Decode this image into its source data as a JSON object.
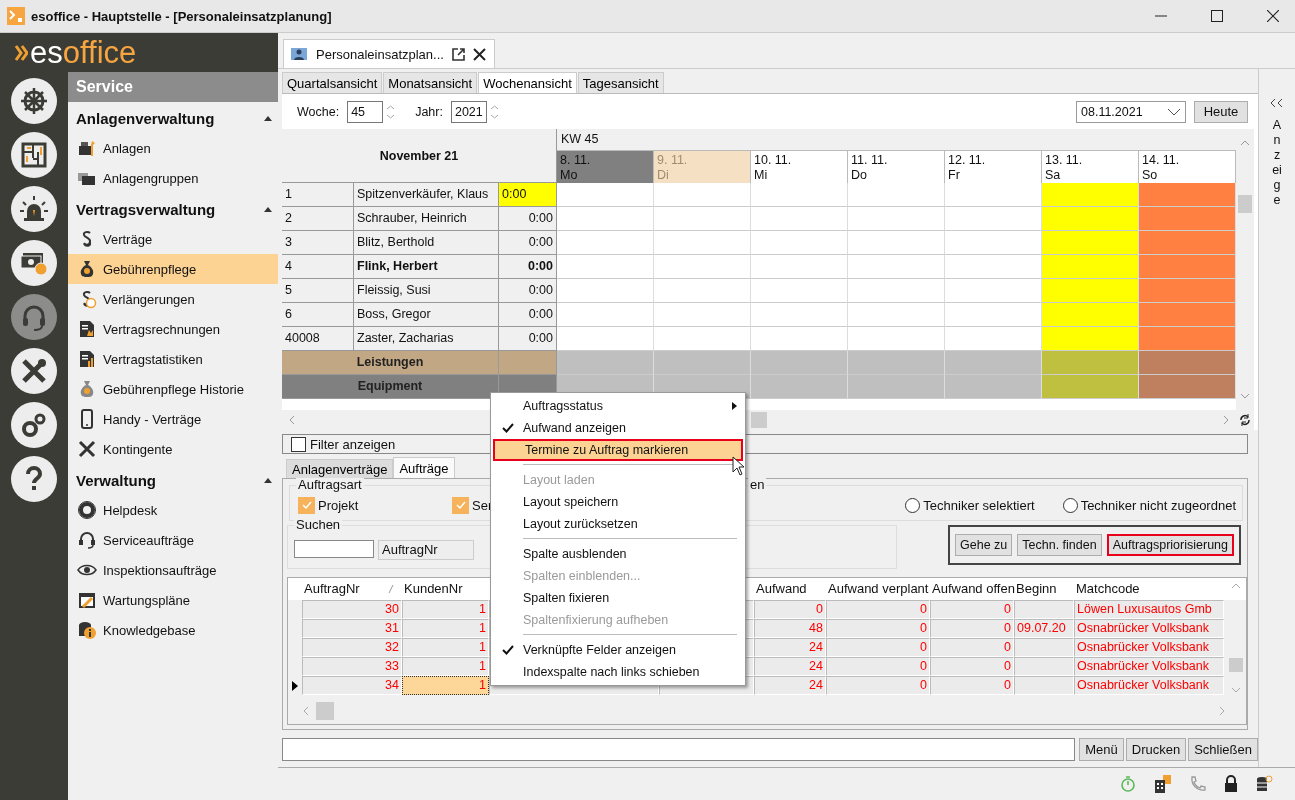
{
  "window": {
    "title": "esoffice - Hauptstelle - [Personaleinsatzplanung]"
  },
  "logo": {
    "part_1": "es",
    "part_2": "office"
  },
  "rail": [
    {
      "selected": false
    },
    {
      "selected": false
    },
    {
      "selected": false
    },
    {
      "selected": false
    },
    {
      "selected": true
    },
    {
      "selected": false
    },
    {
      "selected": false
    },
    {
      "selected": false
    }
  ],
  "sidebar": {
    "title": "Service",
    "sections": [
      {
        "title": "Anlagenverwaltung",
        "expanded": true,
        "items": [
          {
            "label": "Anlagen",
            "selected": false
          },
          {
            "label": "Anlagengruppen",
            "selected": false
          }
        ]
      },
      {
        "title": "Vertragsverwaltung",
        "expanded": true,
        "items": [
          {
            "label": "Verträge",
            "selected": false
          },
          {
            "label": "Gebührenpflege",
            "selected": true
          },
          {
            "label": "Verlängerungen",
            "selected": false
          },
          {
            "label": "Vertragsrechnungen",
            "selected": false
          },
          {
            "label": "Vertragstatistiken",
            "selected": false
          },
          {
            "label": "Gebührenpflege Historie",
            "selected": false
          },
          {
            "label": "Handy - Verträge",
            "selected": false
          },
          {
            "label": "Kontingente",
            "selected": false
          }
        ]
      },
      {
        "title": "Verwaltung",
        "expanded": true,
        "items": [
          {
            "label": "Helpdesk",
            "selected": false
          },
          {
            "label": "Serviceaufträge",
            "selected": false
          },
          {
            "label": "Inspektionsaufträge",
            "selected": false
          },
          {
            "label": "Wartungspläne",
            "selected": false
          },
          {
            "label": "Knowledgebase",
            "selected": false
          }
        ]
      }
    ]
  },
  "document_tab": {
    "title": "Personaleinsatzplan..."
  },
  "view_tabs": [
    {
      "label": "Quartalsansicht",
      "selected": false
    },
    {
      "label": "Monatsansicht",
      "selected": false
    },
    {
      "label": "Wochenansicht",
      "selected": true
    },
    {
      "label": "Tagesansicht",
      "selected": false
    }
  ],
  "toolbar": {
    "week_label": "Woche:",
    "week": "45",
    "year_label": "Jahr:",
    "year": "2021",
    "date": "08.11.2021",
    "today_button": "Heute"
  },
  "side_panel": {
    "title": "Anzeige"
  },
  "planner": {
    "month": "November 21",
    "week": "KW 45",
    "days": [
      {
        "date": "8. 11.",
        "weekday": "Mo",
        "selected": true,
        "today": false,
        "color": "#ffffff"
      },
      {
        "date": "9. 11.",
        "weekday": "Di",
        "selected": false,
        "today": true,
        "color": "#ffffff"
      },
      {
        "date": "10. 11.",
        "weekday": "Mi",
        "selected": false,
        "today": false,
        "color": "#ffffff"
      },
      {
        "date": "11. 11.",
        "weekday": "Do",
        "selected": false,
        "today": false,
        "color": "#ffffff"
      },
      {
        "date": "12. 11.",
        "weekday": "Fr",
        "selected": false,
        "today": false,
        "color": "#ffffff"
      },
      {
        "date": "13. 11.",
        "weekday": "Sa",
        "selected": false,
        "today": false,
        "color": "#ffff00"
      },
      {
        "date": "14. 11.",
        "weekday": "So",
        "selected": false,
        "today": false,
        "color": "#ff8040"
      }
    ],
    "rows": [
      {
        "kind": "person",
        "number": "1",
        "name": "Spitzenverkäufer, Klaus",
        "hours": "0:00",
        "marked": true,
        "bold": false
      },
      {
        "kind": "person",
        "number": "2",
        "name": "Schrauber, Heinrich",
        "hours": "0:00",
        "marked": false,
        "bold": false
      },
      {
        "kind": "person",
        "number": "3",
        "name": "Blitz, Berthold",
        "hours": "0:00",
        "marked": false,
        "bold": false
      },
      {
        "kind": "person",
        "number": "4",
        "name": "Flink, Herbert",
        "hours": "0:00",
        "marked": false,
        "bold": true
      },
      {
        "kind": "person",
        "number": "5",
        "name": "Fleissig, Susi",
        "hours": "0:00",
        "marked": false,
        "bold": false
      },
      {
        "kind": "person",
        "number": "6",
        "name": "Boss, Gregor",
        "hours": "0:00",
        "marked": false,
        "bold": false
      },
      {
        "kind": "person",
        "number": "40008",
        "name": "Zaster, Zacharias",
        "hours": "0:00",
        "marked": false,
        "bold": false
      },
      {
        "kind": "group",
        "title": "Leistungen",
        "color": "#c2a784"
      },
      {
        "kind": "group",
        "title": "Equipment",
        "color": "#808080"
      }
    ]
  },
  "filter": {
    "label": "Filter anzeigen",
    "checked": false
  },
  "lower_tabs": [
    {
      "label": "Anlagenverträge",
      "selected": false
    },
    {
      "label": "Aufträge",
      "selected": true
    }
  ],
  "order_type": {
    "title": "Auftragsart",
    "options": [
      {
        "label": "Projekt",
        "checked": true
      },
      {
        "label": "Ser",
        "checked": true
      }
    ],
    "second_title": "en",
    "radios": [
      {
        "label": "Techniker selektiert",
        "selected": false
      },
      {
        "label": "Techniker nicht zugeordnet",
        "selected": false
      }
    ]
  },
  "search": {
    "title": "Suchen",
    "field": "AuftragNr"
  },
  "actions": [
    {
      "label": "Gehe zu",
      "highlighted": false
    },
    {
      "label": "Techn. finden",
      "highlighted": false
    },
    {
      "label": "Auftragspriorisierung",
      "highlighted": true
    }
  ],
  "orders": {
    "columns": [
      "AuftragNr",
      "KundenNr",
      "Aufwand",
      "Aufwand verplant",
      "Aufwand offen",
      "Beginn",
      "Matchcode"
    ],
    "rows": [
      {
        "auftrag_nr": "30",
        "kunden_nr": "1",
        "aufwand": "0",
        "verplant": "0",
        "offen": "0",
        "matchcode": "Löwen Luxusautos Gmb",
        "selected": false
      },
      {
        "auftrag_nr": "31",
        "kunden_nr": "1",
        "aufwand": "48",
        "verplant": "0",
        "offen": "0",
        "beginn": "09.07.20",
        "matchcode": "Osnabrücker Volksbank",
        "selected": false
      },
      {
        "auftrag_nr": "32",
        "kunden_nr": "1",
        "aufwand": "24",
        "verplant": "0",
        "offen": "0",
        "matchcode": "Osnabrücker Volksbank",
        "selected": false
      },
      {
        "auftrag_nr": "33",
        "kunden_nr": "1",
        "aufwand": "24",
        "verplant": "0",
        "offen": "0",
        "matchcode": "Osnabrücker Volksbank",
        "selected": false
      },
      {
        "auftrag_nr": "34",
        "kunden_nr": "1",
        "aufwand": "24",
        "verplant": "0",
        "offen": "0",
        "matchcode": "Osnabrücker Volksbank",
        "selected": true
      }
    ]
  },
  "context_menu": {
    "items": [
      {
        "kind": "item",
        "label": "Auftragsstatus",
        "submenu": true,
        "checked": false,
        "disabled": false,
        "selected": false
      },
      {
        "kind": "item",
        "label": "Aufwand anzeigen",
        "submenu": false,
        "checked": true,
        "disabled": false,
        "selected": false
      },
      {
        "kind": "item",
        "label": "Termine zu Auftrag markieren",
        "submenu": false,
        "checked": false,
        "disabled": false,
        "selected": true
      },
      {
        "kind": "separator"
      },
      {
        "kind": "item",
        "label": "Layout laden",
        "submenu": false,
        "checked": false,
        "disabled": true,
        "selected": false
      },
      {
        "kind": "item",
        "label": "Layout speichern",
        "submenu": false,
        "checked": false,
        "disabled": false,
        "selected": false
      },
      {
        "kind": "item",
        "label": "Layout zurücksetzen",
        "submenu": false,
        "checked": false,
        "disabled": false,
        "selected": false
      },
      {
        "kind": "separator"
      },
      {
        "kind": "item",
        "label": "Spalte ausblenden",
        "submenu": false,
        "checked": false,
        "disabled": false,
        "selected": false
      },
      {
        "kind": "item",
        "label": "Spalten einblenden...",
        "submenu": false,
        "checked": false,
        "disabled": true,
        "selected": false
      },
      {
        "kind": "item",
        "label": "Spalten fixieren",
        "submenu": false,
        "checked": false,
        "disabled": false,
        "selected": false
      },
      {
        "kind": "item",
        "label": "Spaltenfixierung aufheben",
        "submenu": false,
        "checked": false,
        "disabled": true,
        "selected": false
      },
      {
        "kind": "separator"
      },
      {
        "kind": "item",
        "label": "Verknüpfte Felder anzeigen",
        "submenu": false,
        "checked": true,
        "disabled": false,
        "selected": false
      },
      {
        "kind": "item",
        "label": "Indexspalte nach links schieben",
        "submenu": false,
        "checked": false,
        "disabled": false,
        "selected": false
      }
    ]
  },
  "bottom_bar": {
    "buttons": [
      "Menü",
      "Drucken",
      "Schließen"
    ]
  }
}
